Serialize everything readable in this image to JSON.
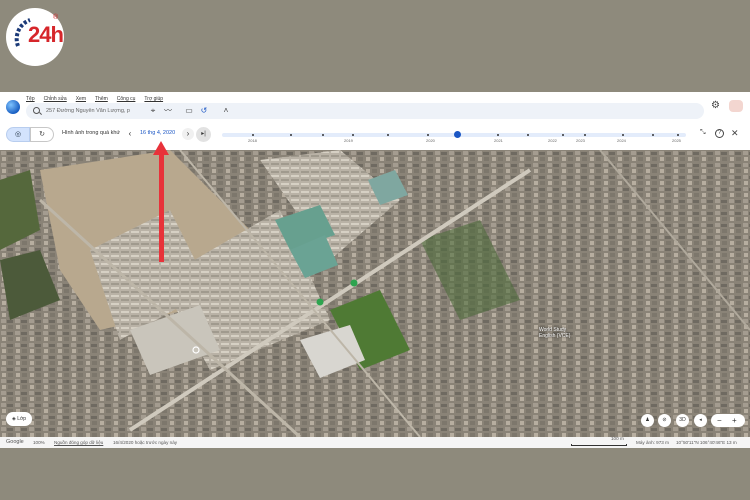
{
  "logo": {
    "text": "24h",
    "registered": "®"
  },
  "menu": [
    "Tệp",
    "Chỉnh sửa",
    "Xem",
    "Thêm",
    "Công cụ",
    "Trợ giúp"
  ],
  "search": {
    "value": "257 Đường Nguyễn Văn Lượng, p"
  },
  "history": {
    "label": "Hình ảnh trong quá khứ",
    "date": "16 thg 4, 2020",
    "years": [
      "2018",
      "2019",
      "2020",
      "2021",
      "2022",
      "2023",
      "2024",
      "2025"
    ]
  },
  "map": {
    "place_label": "World Study English (VCE)"
  },
  "controls": {
    "layers_label": "Lớp",
    "3d_label": "3D",
    "zoom_out": "−",
    "zoom_in": "+"
  },
  "status": {
    "google": "Google",
    "zoom": "100%",
    "data_source": "Nguồn đóng góp dữ liệu",
    "imagery_date": "16/4/2020 hoặc trước ngày này",
    "scale": "100 m",
    "camera": "Máy ảnh: 973 m",
    "coords": "10°50'11\"N 106°40'46\"E 13 m"
  },
  "colors": {
    "accent": "#1a56c4",
    "arrow": "#e8323a",
    "logo_red": "#d6262b"
  }
}
